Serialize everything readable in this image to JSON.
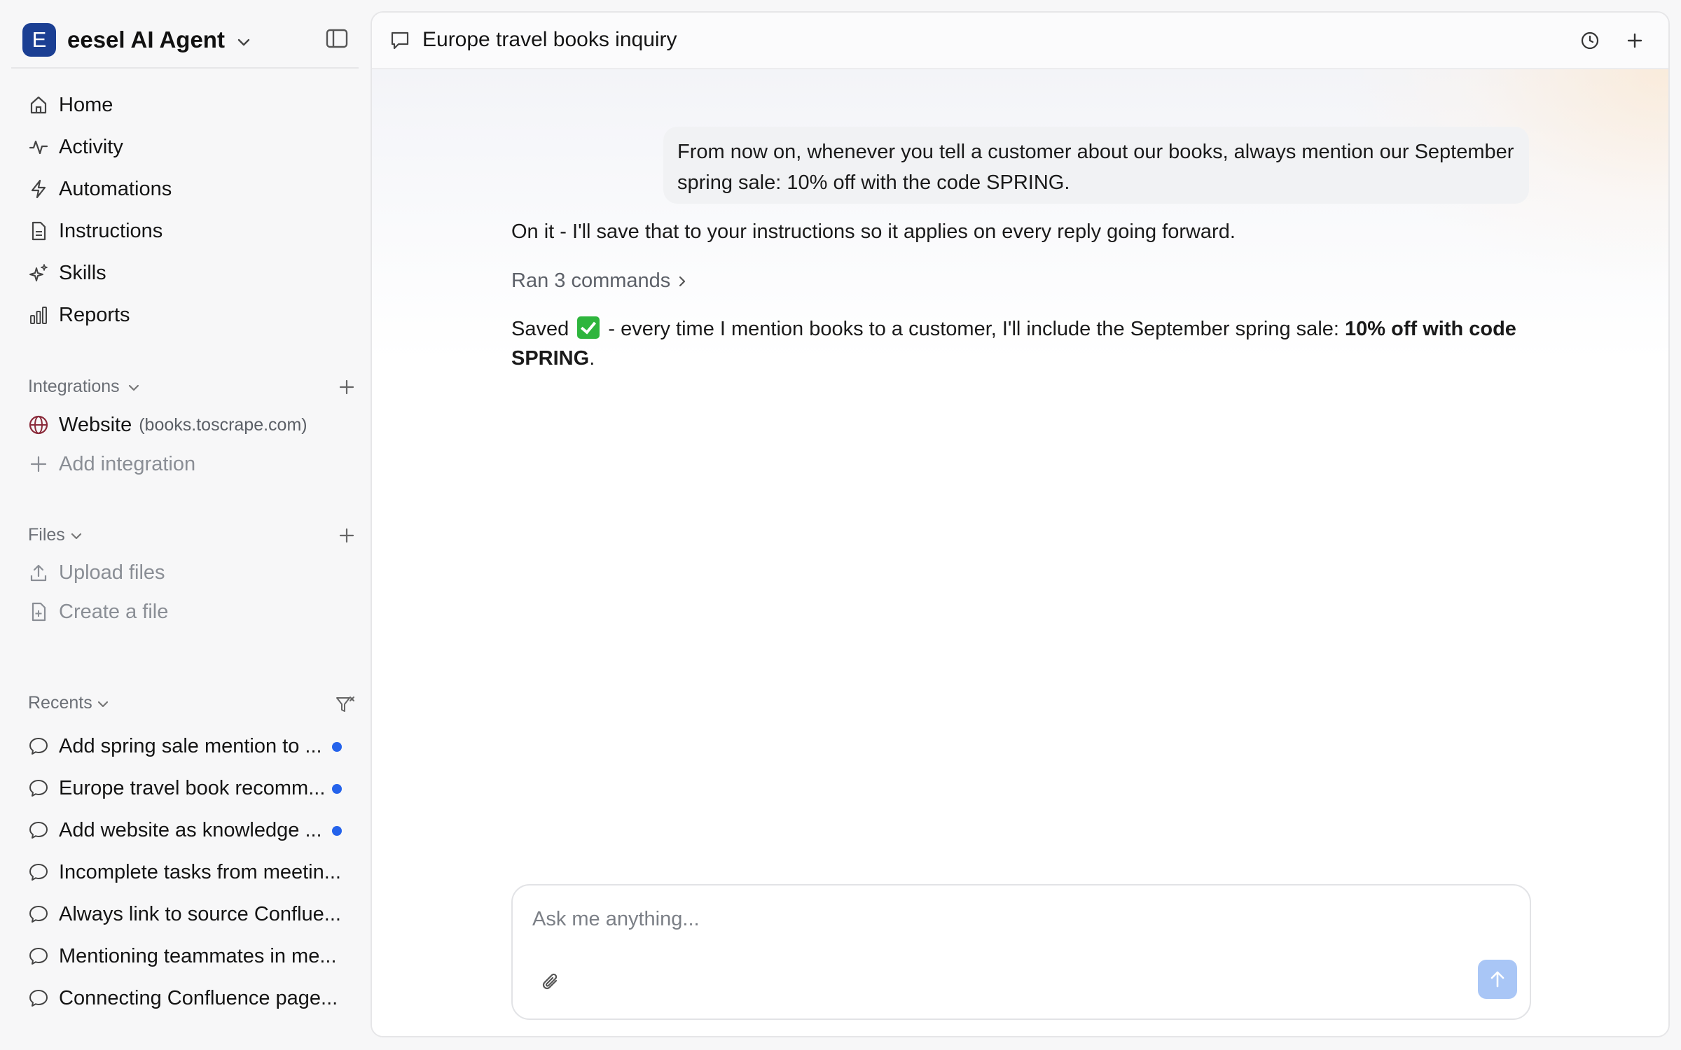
{
  "workspace": {
    "badge": "E",
    "name": "eesel AI Agent"
  },
  "nav": {
    "items": [
      {
        "label": "Home",
        "icon": "home-icon"
      },
      {
        "label": "Activity",
        "icon": "activity-icon"
      },
      {
        "label": "Automations",
        "icon": "bolt-icon"
      },
      {
        "label": "Instructions",
        "icon": "document-icon"
      },
      {
        "label": "Skills",
        "icon": "sparkles-icon"
      },
      {
        "label": "Reports",
        "icon": "bar-chart-icon"
      }
    ]
  },
  "integrations": {
    "title": "Integrations",
    "website_label": "Website",
    "website_domain": "(books.toscrape.com)",
    "add_label": "Add integration"
  },
  "files": {
    "title": "Files",
    "upload_label": "Upload files",
    "create_label": "Create a file"
  },
  "recents": {
    "title": "Recents",
    "items": [
      {
        "label": "Add spring sale mention to ...",
        "unread": true
      },
      {
        "label": "Europe travel book recomm...",
        "unread": true
      },
      {
        "label": "Add website as knowledge ...",
        "unread": true
      },
      {
        "label": "Incomplete tasks from meetin...",
        "unread": false
      },
      {
        "label": "Always link to source Conflue...",
        "unread": false
      },
      {
        "label": "Mentioning teammates in me...",
        "unread": false
      },
      {
        "label": "Connecting Confluence page...",
        "unread": false
      }
    ]
  },
  "chat": {
    "title": "Europe travel books inquiry",
    "user_message": "From now on, whenever you tell a customer about our books, always mention our September spring sale: 10% off with the code SPRING.",
    "ai_reply": "On it - I'll save that to your instructions so it applies on every reply going forward.",
    "commands_label": "Ran 3 commands",
    "saved_prefix": "Saved",
    "saved_middle": " - every time I mention books to a customer, I'll include the September spring sale: ",
    "saved_bold": "10% off with code SPRING",
    "saved_suffix": "."
  },
  "composer": {
    "placeholder": "Ask me anything..."
  },
  "colors": {
    "accent": "#1b3f93",
    "unread_dot": "#2563eb",
    "send_button": "#a9c6f6",
    "check": "#2eb53d"
  }
}
